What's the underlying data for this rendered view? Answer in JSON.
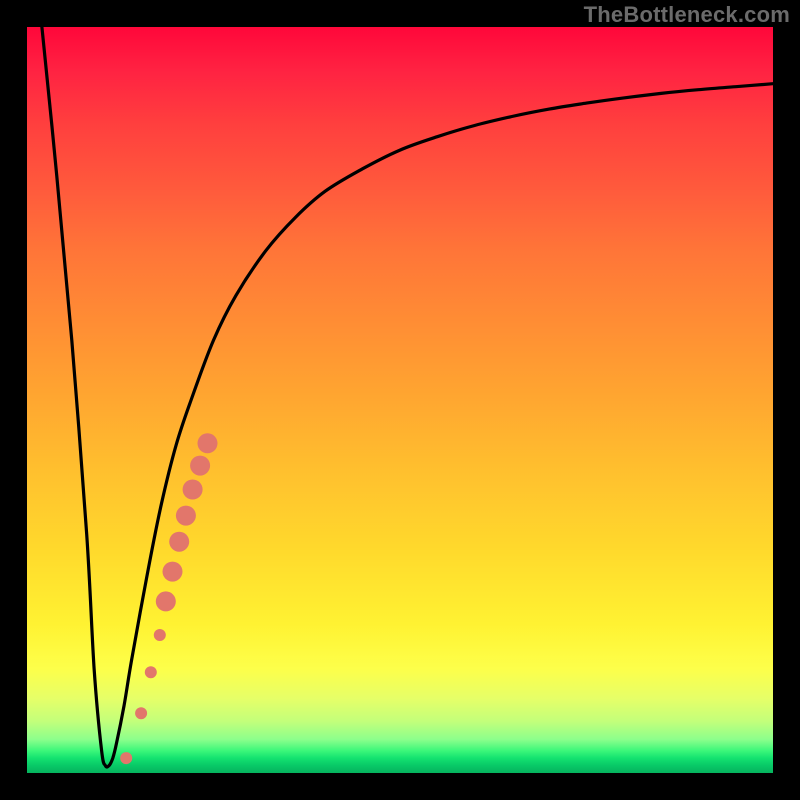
{
  "watermark": "TheBottleneck.com",
  "colors": {
    "curve_stroke": "#000000",
    "dot_fill": "#e2766b",
    "dot_stroke": "#c9574c",
    "frame_bg": "#000000"
  },
  "chart_data": {
    "type": "line",
    "title": "",
    "xlabel": "",
    "ylabel": "",
    "xlim": [
      0,
      100
    ],
    "ylim": [
      0,
      100
    ],
    "grid": false,
    "legend": false,
    "series": [
      {
        "name": "bottleneck-curve",
        "x": [
          2,
          4,
          6,
          8,
          9,
          10,
          10.5,
          11,
          11.5,
          12,
          13,
          14,
          16,
          18,
          20,
          22,
          25,
          28,
          32,
          36,
          40,
          45,
          50,
          55,
          60,
          65,
          70,
          75,
          80,
          85,
          90,
          95,
          100
        ],
        "y": [
          100,
          80,
          58,
          32,
          14,
          3,
          1,
          1,
          2,
          4,
          9,
          15,
          26,
          36,
          44,
          50,
          58,
          64,
          70,
          74.5,
          78,
          81,
          83.5,
          85.3,
          86.8,
          88,
          89,
          89.8,
          90.5,
          91.1,
          91.6,
          92,
          92.4
        ]
      }
    ],
    "dots_series": {
      "name": "highlighted-points",
      "points": [
        {
          "x": 13.3,
          "y": 2.0,
          "r": 6
        },
        {
          "x": 15.3,
          "y": 8.0,
          "r": 6
        },
        {
          "x": 16.6,
          "y": 13.5,
          "r": 6
        },
        {
          "x": 17.8,
          "y": 18.5,
          "r": 6
        },
        {
          "x": 18.6,
          "y": 23.0,
          "r": 10
        },
        {
          "x": 19.5,
          "y": 27.0,
          "r": 10
        },
        {
          "x": 20.4,
          "y": 31.0,
          "r": 10
        },
        {
          "x": 21.3,
          "y": 34.5,
          "r": 10
        },
        {
          "x": 22.2,
          "y": 38.0,
          "r": 10
        },
        {
          "x": 23.2,
          "y": 41.2,
          "r": 10
        },
        {
          "x": 24.2,
          "y": 44.2,
          "r": 10
        }
      ]
    }
  }
}
